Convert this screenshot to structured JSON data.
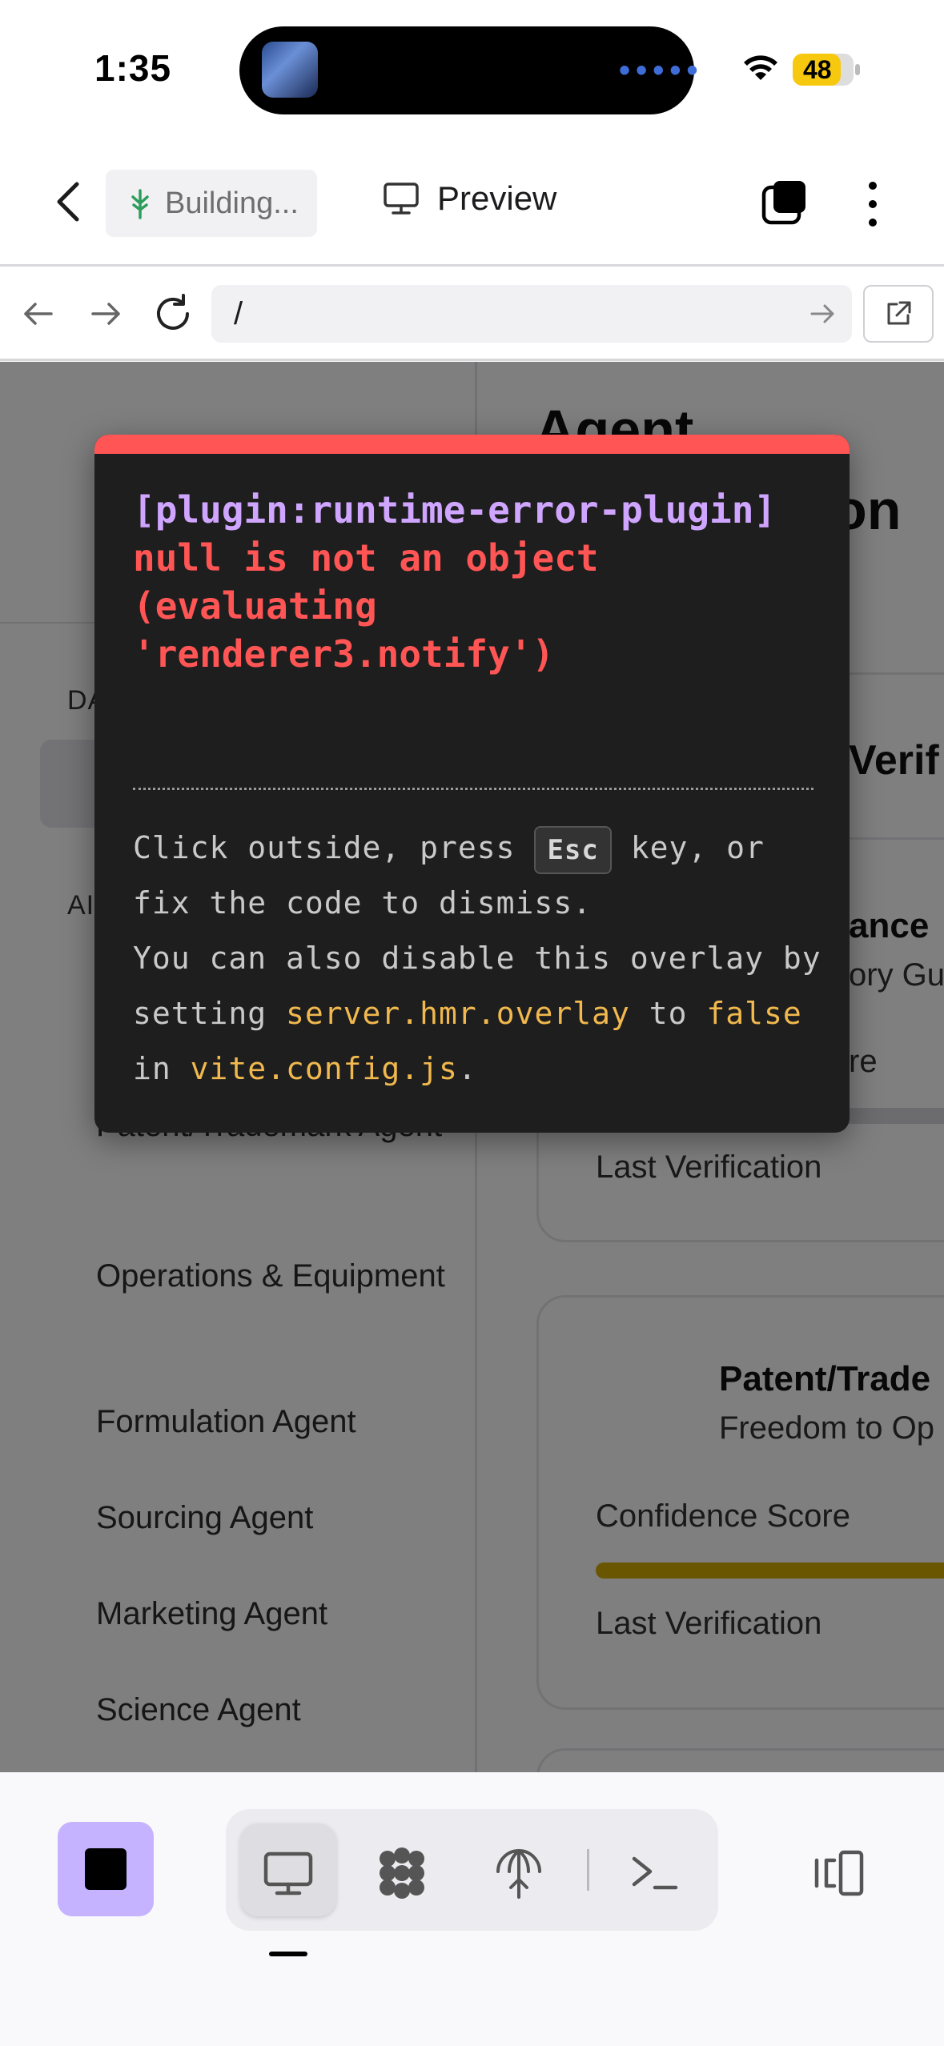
{
  "status_bar": {
    "time": "1:35",
    "battery": "48"
  },
  "header": {
    "building_label": "Building...",
    "preview_label": "Preview"
  },
  "url_bar": {
    "url": "/"
  },
  "sidebar": {
    "section_dashboard": "DA",
    "section_agents": "AI",
    "items": [
      "Patent/Trademark Agent",
      "Operations & Equipment",
      "Formulation Agent",
      "Sourcing Agent",
      "Marketing Agent",
      "Science Agent"
    ]
  },
  "main": {
    "title_line1": "Agent",
    "title_line2": "on",
    "section_title": "Verif",
    "card1": {
      "title": "ance",
      "subtitle": "ory Gui",
      "confidence_label": "re",
      "last_label": "Last Verification"
    },
    "card2": {
      "title": "Patent/Trade",
      "subtitle": "Freedom to Op",
      "confidence_label": "Confidence Score",
      "last_label": "Last Verification",
      "bar_color": "#d4aa00"
    }
  },
  "error_overlay": {
    "plugin": "[plugin:runtime-error-plugin]",
    "message": "null is not an object\n(evaluating\n'renderer3.notify')",
    "tip_1": "Click outside, press ",
    "tip_key": "Esc",
    "tip_2": " key, or fix the code to dismiss.",
    "tip_3": "You can also disable this overlay by setting ",
    "tip_code1": "server.hmr.overlay",
    "tip_4": " to ",
    "tip_code2": "false",
    "tip_5": " in ",
    "tip_code3": "vite.config.js",
    "tip_6": "."
  },
  "colors": {
    "accent_purple": "#c5b3ff",
    "error_red": "#ff5555",
    "code_yellow": "#f0b84e",
    "plugin_purple": "#cfa5ff"
  },
  "icons": [
    "back-chevron-icon",
    "building-tree-icon",
    "monitor-icon",
    "toggle-windows-icon",
    "more-vertical-icon",
    "arrow-left-icon",
    "arrow-right-icon",
    "reload-icon",
    "arrow-go-icon",
    "open-external-icon",
    "stop-icon",
    "desktop-icon",
    "shapes-icon",
    "deploy-icon",
    "terminal-icon",
    "panel-toggle-icon"
  ]
}
